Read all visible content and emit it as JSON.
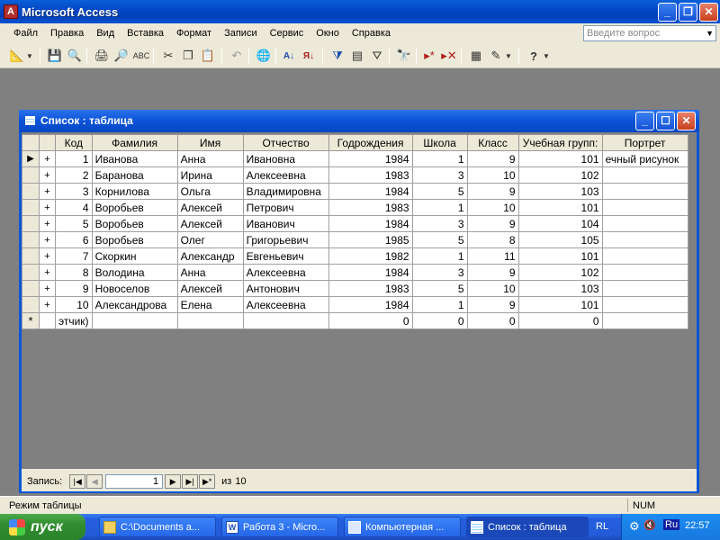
{
  "app": {
    "title": "Microsoft Access"
  },
  "menu": [
    "Файл",
    "Правка",
    "Вид",
    "Вставка",
    "Формат",
    "Записи",
    "Сервис",
    "Окно",
    "Справка"
  ],
  "help_placeholder": "Введите вопрос",
  "toolbar_icons": [
    "design-view-icon",
    "save-icon",
    "print-preview-icon",
    "print-icon",
    "spell-check-icon",
    "cut-icon",
    "copy-icon",
    "paste-icon",
    "undo-icon",
    "hyperlink-icon",
    "sort-ascending-icon",
    "sort-descending-icon",
    "filter-by-selection-icon",
    "filter-by-form-icon",
    "apply-filter-icon",
    "find-icon",
    "new-record-icon",
    "delete-record-icon",
    "properties-icon",
    "new-object-icon",
    "help-icon"
  ],
  "window": {
    "title": "Список : таблица"
  },
  "table": {
    "columns": [
      "Код",
      "Фамилия",
      "Имя",
      "Отчество",
      "Годрождения",
      "Школа",
      "Класс",
      "Учебная групп:",
      "Портрет"
    ],
    "rows": [
      [
        "1",
        "Иванова",
        "Анна",
        "Ивановна",
        "1984",
        "1",
        "9",
        "101",
        "ечный рисунок"
      ],
      [
        "2",
        "Баранова",
        "Ирина",
        "Алексеевна",
        "1983",
        "3",
        "10",
        "102",
        ""
      ],
      [
        "3",
        "Корнилова",
        "Ольга",
        "Владимировна",
        "1984",
        "5",
        "9",
        "103",
        ""
      ],
      [
        "4",
        "Воробьев",
        "Алексей",
        "Петрович",
        "1983",
        "1",
        "10",
        "101",
        ""
      ],
      [
        "5",
        "Воробьев",
        "Алексей",
        "Иванович",
        "1984",
        "3",
        "9",
        "104",
        ""
      ],
      [
        "6",
        "Воробьев",
        "Олег",
        "Григорьевич",
        "1985",
        "5",
        "8",
        "105",
        ""
      ],
      [
        "7",
        "Скоркин",
        "Александр",
        "Евгеньевич",
        "1982",
        "1",
        "11",
        "101",
        ""
      ],
      [
        "8",
        "Володина",
        "Анна",
        "Алексеевна",
        "1984",
        "3",
        "9",
        "102",
        ""
      ],
      [
        "9",
        "Новоселов",
        "Алексей",
        "Антонович",
        "1983",
        "5",
        "10",
        "103",
        ""
      ],
      [
        "10",
        "Александрова",
        "Елена",
        "Алексеевна",
        "1984",
        "1",
        "9",
        "101",
        ""
      ]
    ],
    "new_row": [
      "этчик)",
      "",
      "",
      "",
      "0",
      "0",
      "0",
      "0",
      ""
    ],
    "current_row_marker": "▶",
    "new_row_marker": "*",
    "expand_marker": "+"
  },
  "nav": {
    "label": "Запись:",
    "current": "1",
    "of_label": "из",
    "total": "10"
  },
  "status": {
    "left": "Режим таблицы",
    "right": "NUM"
  },
  "taskbar": {
    "start": "пуск",
    "tasks": [
      "C:\\Documents a...",
      "Работа 3 - Micro...",
      "Компьютерная ...",
      "Список : таблица"
    ],
    "lang": "RL",
    "tray_lang": "Ru",
    "clock": "22:57"
  }
}
